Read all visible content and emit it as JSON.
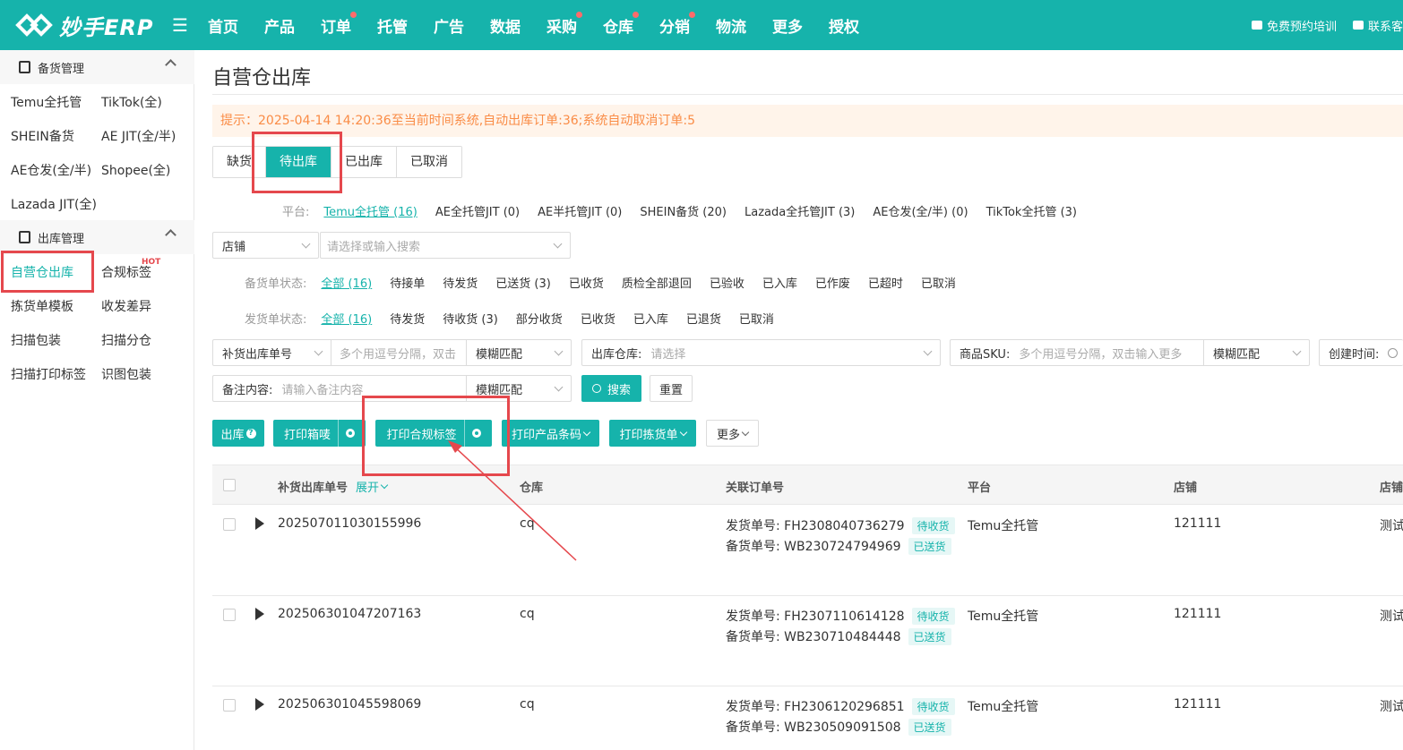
{
  "app": {
    "logo_text": "妙手ERP"
  },
  "nav": {
    "items": [
      {
        "label": "首页",
        "dot": false
      },
      {
        "label": "产品",
        "dot": false
      },
      {
        "label": "订单",
        "dot": true
      },
      {
        "label": "托管",
        "dot": false
      },
      {
        "label": "广告",
        "dot": false
      },
      {
        "label": "数据",
        "dot": false
      },
      {
        "label": "采购",
        "dot": true
      },
      {
        "label": "仓库",
        "dot": true
      },
      {
        "label": "分销",
        "dot": true
      },
      {
        "label": "物流",
        "dot": false
      },
      {
        "label": "更多",
        "dot": false
      },
      {
        "label": "授权",
        "dot": false
      }
    ]
  },
  "top_right": {
    "training": "免费预约培训",
    "contact": "联系客"
  },
  "sidebar": {
    "group1": "备货管理",
    "group1_items": [
      "Temu全托管",
      "TikTok(全)",
      "SHEIN备货",
      "AE JIT(全/半)",
      "AE仓发(全/半)",
      "Shopee(全)",
      "Lazada JIT(全)"
    ],
    "group2": "出库管理",
    "group2_items": [
      "自营仓出库",
      "合规标签",
      "拣货单模板",
      "收发差异",
      "扫描包装",
      "扫描分仓",
      "扫描打印标签",
      "识图包装"
    ],
    "hot": "HOT"
  },
  "page": {
    "title": "自营仓出库",
    "notice": "提示：2025-04-14 14:20:36至当前时间系统,自动出库订单:36;系统自动取消订单:5"
  },
  "tabs": [
    "缺货",
    "待出库",
    "已出库",
    "已取消"
  ],
  "filters": {
    "platform_label": "平台:",
    "platforms": [
      "Temu全托管 (16)",
      "AE全托管JIT (0)",
      "AE半托管JIT (0)",
      "SHEIN备货 (20)",
      "Lazada全托管JIT (3)",
      "AE仓发(全/半) (0)",
      "TikTok全托管 (3)"
    ],
    "store_select": "店铺",
    "store_placeholder": "请选择或输入搜索",
    "stock_status_label": "备货单状态:",
    "stock_status": [
      "全部 (16)",
      "待接单",
      "待发货",
      "已送货 (3)",
      "已收货",
      "质检全部退回",
      "已验收",
      "已入库",
      "已作废",
      "已超时",
      "已取消"
    ],
    "ship_status_label": "发货单状态:",
    "ship_status": [
      "全部 (16)",
      "待发货",
      "待收货 (3)",
      "部分收货",
      "已收货",
      "已入库",
      "已退货",
      "已取消"
    ]
  },
  "search": {
    "order_no_select": "补货出库单号",
    "order_no_placeholder": "多个用逗号分隔，双击",
    "match1": "模糊匹配",
    "warehouse_label": "出库仓库:",
    "warehouse_placeholder": "请选择",
    "sku_label": "商品SKU:",
    "sku_placeholder": "多个用逗号分隔，双击输入更多",
    "match2": "模糊匹配",
    "created_label": "创建时间:",
    "remark_label": "备注内容:",
    "remark_placeholder": "请输入备注内容",
    "match3": "模糊匹配",
    "search_btn": "搜索",
    "reset_btn": "重置"
  },
  "actions": {
    "outbound": "出库",
    "print_box": "打印箱唛",
    "print_compliance": "打印合规标签",
    "print_barcode": "打印产品条码",
    "print_pick": "打印拣货单",
    "more": "更多"
  },
  "table": {
    "headers": {
      "order_no": "补货出库单号",
      "expand": "展开",
      "warehouse": "仓库",
      "related": "关联订单号",
      "platform": "平台",
      "store": "店铺",
      "store_name": "店铺"
    },
    "rows": [
      {
        "order_no": "202507011030155996",
        "warehouse": "cq",
        "ship_label": "发货单号:",
        "ship_no": "FH2308040736279",
        "ship_tag": "待收货",
        "stock_label": "备货单号:",
        "stock_no": "WB230724794969",
        "stock_tag": "已送货",
        "platform": "Temu全托管",
        "store": "121111",
        "store_name": "测试"
      },
      {
        "order_no": "202506301047207163",
        "warehouse": "cq",
        "ship_label": "发货单号:",
        "ship_no": "FH2307110614128",
        "ship_tag": "待收货",
        "stock_label": "备货单号:",
        "stock_no": "WB230710484448",
        "stock_tag": "已送货",
        "platform": "Temu全托管",
        "store": "121111",
        "store_name": "测试"
      },
      {
        "order_no": "202506301045598069",
        "warehouse": "cq",
        "ship_label": "发货单号:",
        "ship_no": "FH2306120296851",
        "ship_tag": "待收货",
        "stock_label": "备货单号:",
        "stock_no": "WB230509091508",
        "stock_tag": "已送货",
        "platform": "Temu全托管",
        "store": "121111",
        "store_name": "测试"
      }
    ]
  },
  "colors": {
    "brand": "#16b3ab",
    "highlight": "#e5484d",
    "notice_bg": "#fff4ea",
    "notice_text": "#fa8c46"
  }
}
